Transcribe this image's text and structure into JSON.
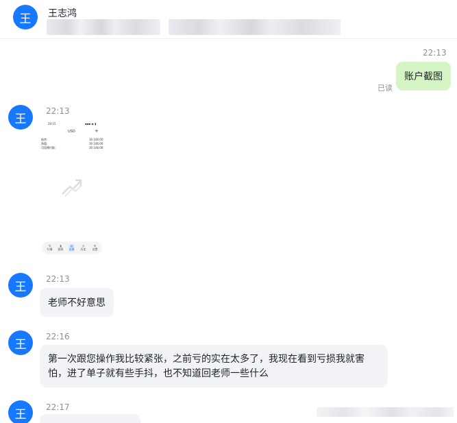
{
  "header": {
    "avatar_text": "王",
    "contact_name": "王志鸿"
  },
  "messages": {
    "out_time": "22:13",
    "out_text": "账户截图",
    "read_status": "已读",
    "img_time": "22:13",
    "img_avatar": "王",
    "msg1_time": "22:13",
    "msg1_avatar": "王",
    "msg1_text": "老师不好意思",
    "msg2_time": "22:16",
    "msg2_avatar": "王",
    "msg2_text": "第一次跟您操作我比较紧张，之前亏的实在太多了，我现在看到亏损我就害怕，进了单子就有些手抖，也不知道回老师一些什么",
    "msg3_time": "22:17",
    "msg3_avatar": "王"
  },
  "screenshot": {
    "time": "20:15",
    "status": "▪▪▪ ◉ ▮",
    "currency": "USD",
    "plus": "+",
    "rows": [
      {
        "label": "结余:",
        "value": "30 146.00"
      },
      {
        "label": "净值:",
        "value": "30 146.00"
      },
      {
        "label": "可用预付款:",
        "value": "30 146.06"
      }
    ],
    "nav": [
      "行情",
      "图表",
      "交易",
      "历史",
      "设置"
    ]
  },
  "colors": {
    "avatar": "#1677ff",
    "out_bubble": "#d6f5c4",
    "in_bubble": "#f1f3f7"
  }
}
